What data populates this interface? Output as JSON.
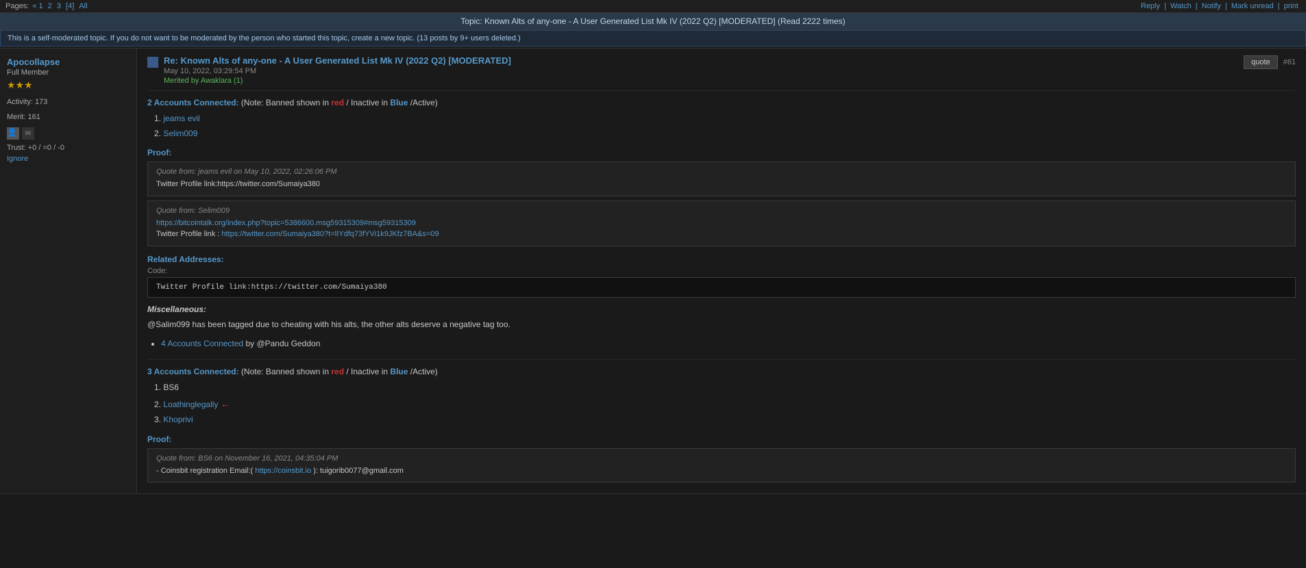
{
  "pages_bar": {
    "pages_label": "Pages:",
    "page_links": [
      "« 1",
      "2",
      "3",
      "[4]",
      "All"
    ],
    "actions": [
      "Reply",
      "Watch",
      "Notify",
      "Mark unread",
      "print"
    ]
  },
  "topic_title": "Topic: Known Alts of any-one - A User Generated List Mk IV (2022 Q2) [MODERATED]   (Read 2222 times)",
  "moderation_notice": "This is a self-moderated topic. If you do not want to be moderated by the person who started this topic, create a new topic. (13 posts by 9+ users deleted.)",
  "post": {
    "author": {
      "name": "Apocollapse",
      "rank": "Full Member",
      "stars": "★★★",
      "activity_label": "Activity:",
      "activity_value": "173",
      "merit_label": "Merit:",
      "merit_value": "161",
      "trust": "Trust: +0 / =0 / -0",
      "ignore_label": "Ignore"
    },
    "title": "Re: Known Alts of any-one - A User Generated List Mk IV (2022 Q2) [MODERATED]",
    "date": "May 10, 2022, 03:29:54 PM",
    "merit_text": "Merited by",
    "merit_by": "Awaklara",
    "merit_count": "(1)",
    "quote_btn": "quote",
    "post_number": "#61",
    "section1": {
      "header_start": "2 Accounts Connected:",
      "note": "(Note: Banned shown in",
      "red_word": "red",
      "slash": "/",
      "inactive_word": "Inactive in",
      "blue_word": "Blue",
      "active": "/Active)",
      "accounts": [
        {
          "num": "1.",
          "name": "jeams evil",
          "style": "normal"
        },
        {
          "num": "2.",
          "name": "Selim009",
          "style": "normal"
        }
      ]
    },
    "proof_label": "Proof:",
    "quote1": {
      "from": "Quote from: jeams evil on May 10, 2022, 02:26:06 PM",
      "text": "Twitter Profile link:https://twitter.com/Sumaiya380"
    },
    "quote2": {
      "from": "Quote from: Selim009",
      "line1": "https://bitcointalk.org/index.php?topic=5386600.msg59315309#msg59315309",
      "line2_prefix": "Twitter Profile link : ",
      "line2_link": "https://twitter.com/Sumaiya380?t=lIYdfq73fYVi1k9JKfz7BA&s=09"
    },
    "related_addresses": "Related Addresses:",
    "code_label": "Code:",
    "code_text": "Twitter Profile link:https://twitter.com/Sumaiya380",
    "miscellaneous": "Miscellaneous:",
    "misc_text": "@Salim099 has been tagged due to cheating with his alts, the other alts deserve a negative tag too.",
    "bullet_item": {
      "link_text": "4 Accounts Connected",
      "by_text": "by @Pandu Geddon"
    },
    "section2": {
      "header_start": "3 Accounts Connected:",
      "note": "(Note: Banned shown in",
      "red_word": "red",
      "slash": "/",
      "inactive_word": "Inactive in",
      "blue_word": "Blue",
      "active": "/Active)",
      "accounts": [
        {
          "num": "1.",
          "name": "BS6",
          "style": "normal"
        },
        {
          "num": "2.",
          "name": "Loathinglegally",
          "style": "blue",
          "arrow": "←"
        },
        {
          "num": "3.",
          "name": "Khoprivi",
          "style": "blue"
        }
      ]
    },
    "proof2_label": "Proof:",
    "quote3": {
      "from": "Quote from: BS6 on November 16, 2021, 04:35:04 PM",
      "line1_prefix": "- Coinsbit registration Email:( ",
      "line1_link": "https://coinsbit.io",
      "line1_suffix": " ): tuigorib0077@gmail.com"
    }
  }
}
